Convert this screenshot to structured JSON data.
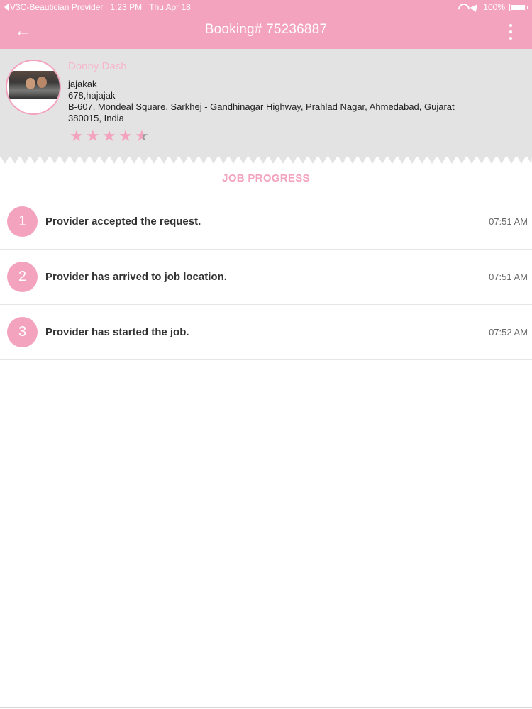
{
  "status_bar": {
    "app_back": "V3C-Beautician Provider",
    "time": "1:23 PM",
    "date": "Thu Apr 18",
    "battery": "100%"
  },
  "app_bar": {
    "title": "Booking# 75236887"
  },
  "customer": {
    "name": "Donny Dash",
    "line1": "jajakak",
    "line2": "678,hajajak",
    "address1": "B-607,  Mondeal Square,  Sarkhej - Gandhinagar Highway,  Prahlad Nagar,  Ahmedabad,  Gujarat",
    "address2": "380015,  India",
    "rating": 4.5,
    "rating_max": 5
  },
  "job_progress": {
    "title": "JOB PROGRESS",
    "steps": [
      {
        "number": "1",
        "text": "Provider accepted the request.",
        "time": "07:51 AM"
      },
      {
        "number": "2",
        "text": "Provider has arrived to job location.",
        "time": "07:51 AM"
      },
      {
        "number": "3",
        "text": "Provider has started the job.",
        "time": "07:52 AM"
      }
    ]
  },
  "colors": {
    "accent": "#f4a3bf",
    "header_bg": "#e3e3e3"
  },
  "icons": {
    "back": "back-arrow-icon",
    "menu": "more-vertical-icon",
    "rating": "star-icon"
  }
}
